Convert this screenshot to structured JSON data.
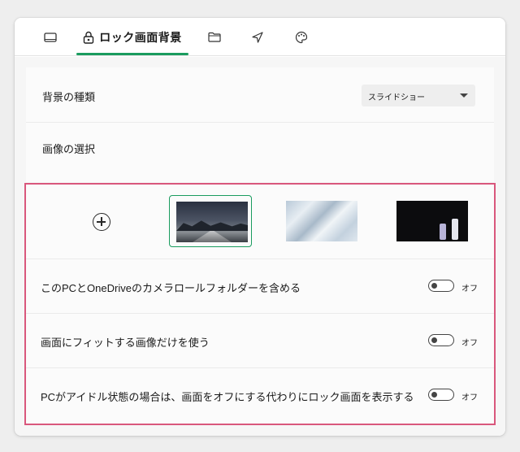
{
  "tabs": [
    {
      "icon": "tablet-icon",
      "label": ""
    },
    {
      "icon": "lock-icon",
      "label": "ロック画面背景",
      "active": true
    },
    {
      "icon": "folder-icon",
      "label": ""
    },
    {
      "icon": "send-icon",
      "label": ""
    },
    {
      "icon": "palette-icon",
      "label": ""
    }
  ],
  "background_type": {
    "label": "背景の種類",
    "selected": "スライドショー"
  },
  "image_selection": {
    "label": "画像の選択",
    "add_icon": "plus-circle-icon",
    "thumbnails": [
      {
        "name": "night-road-mountains",
        "selected": true
      },
      {
        "name": "light-blue-abstract",
        "selected": false
      },
      {
        "name": "anime-characters-dark",
        "selected": false
      }
    ]
  },
  "settings": [
    {
      "label": "このPCとOneDriveのカメラロールフォルダーを含める",
      "state": "オフ"
    },
    {
      "label": "画面にフィットする画像だけを使う",
      "state": "オフ"
    },
    {
      "label": "PCがアイドル状態の場合は、画面をオフにする代わりにロック画面を表示する",
      "state": "オフ"
    }
  ],
  "colors": {
    "accent": "#1a9c5f",
    "highlight_border": "#d9577c"
  }
}
